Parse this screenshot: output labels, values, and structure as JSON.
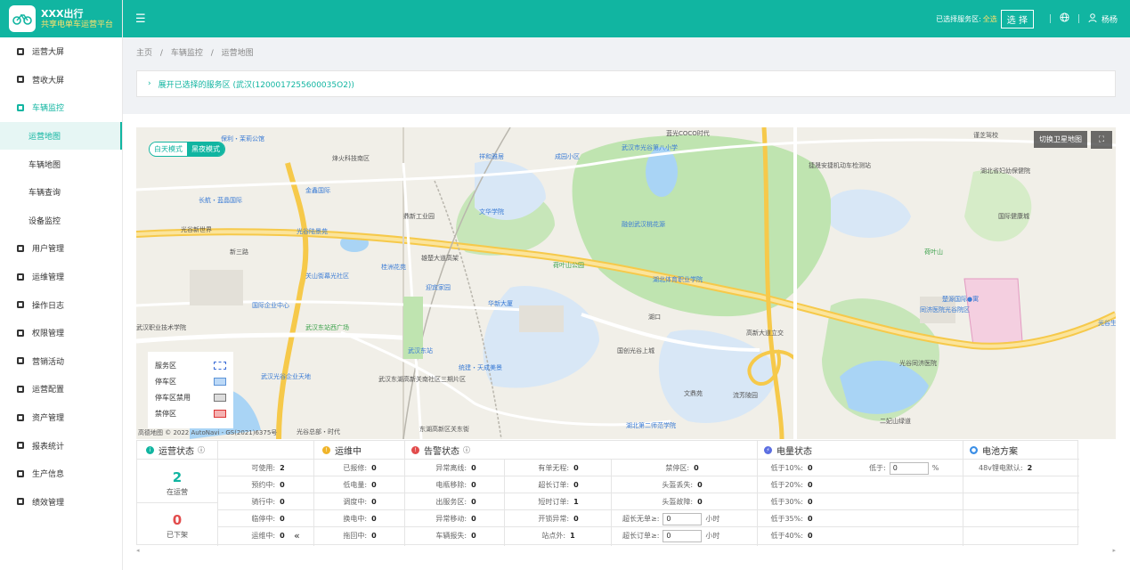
{
  "brand": {
    "title": "XXX出行",
    "subtitle": "共享电单车运营平台"
  },
  "sidebar": {
    "items": [
      {
        "label": "运营大屏",
        "icon": "chart-line-icon"
      },
      {
        "label": "营收大屏",
        "icon": "moneybag-icon"
      },
      {
        "label": "车辆监控",
        "icon": "bike-icon"
      },
      {
        "label": "运营地图",
        "sub": true
      },
      {
        "label": "车辆地图",
        "sub": true
      },
      {
        "label": "车辆查询",
        "sub": true
      },
      {
        "label": "设备监控",
        "sub": true
      },
      {
        "label": "用户管理",
        "icon": "users-icon"
      },
      {
        "label": "运维管理",
        "icon": "wrench-icon"
      },
      {
        "label": "操作日志",
        "icon": "log-icon"
      },
      {
        "label": "权限管理",
        "icon": "shield-icon"
      },
      {
        "label": "营销活动",
        "icon": "gift-icon"
      },
      {
        "label": "运营配置",
        "icon": "config-icon"
      },
      {
        "label": "资产管理",
        "icon": "asset-icon"
      },
      {
        "label": "报表统计",
        "icon": "pie-icon"
      },
      {
        "label": "生产信息",
        "icon": "production-icon"
      },
      {
        "label": "绩效管理",
        "icon": "performance-icon"
      }
    ]
  },
  "header": {
    "service_label": "已选择服务区:",
    "service_value": "全选",
    "select_btn": "选 择",
    "user": "杨杨"
  },
  "breadcrumb": [
    "主页",
    "/",
    "车辆监控",
    "/",
    "运营地图"
  ],
  "service_bar": {
    "text": "展开已选择的服务区 (武汉(1200017255600035O2))"
  },
  "map": {
    "mode_day": "白天模式",
    "mode_night": "黑夜模式",
    "satellite": "切换卫星地图",
    "legend": [
      {
        "label": "服务区"
      },
      {
        "label": "停车区"
      },
      {
        "label": "停车区禁用"
      },
      {
        "label": "禁停区"
      }
    ],
    "copyright": "高德地图 © 2022 AutoNavi - GS(2021)6375号",
    "labels": [
      {
        "t": "保利・茉莉公馆",
        "c": "b"
      },
      {
        "t": "烽火科技南区",
        "c": ""
      },
      {
        "t": "祥和雅居",
        "c": "b"
      },
      {
        "t": "成园小区",
        "c": "b"
      },
      {
        "t": "武汉市光谷第八小学",
        "c": "b"
      },
      {
        "t": "蓝光COCO时代",
        "c": ""
      },
      {
        "t": "捷晟安捷机动车检测站",
        "c": ""
      },
      {
        "t": "谨芝驾校",
        "c": ""
      },
      {
        "t": "湖北省妇幼保健院",
        "c": ""
      },
      {
        "t": "金鑫国际",
        "c": "b"
      },
      {
        "t": "长航・蓝晶国际",
        "c": "b"
      },
      {
        "t": "鼎新工业园",
        "c": ""
      },
      {
        "t": "文华学院",
        "c": "b"
      },
      {
        "t": "融创武汉桃花源",
        "c": "b"
      },
      {
        "t": "光谷新世界",
        "c": ""
      },
      {
        "t": "光谷陆景苑",
        "c": "b"
      },
      {
        "t": "新三路",
        "c": ""
      },
      {
        "t": "桂洲花苑",
        "c": "b"
      },
      {
        "t": "雄楚大道高架",
        "c": ""
      },
      {
        "t": "荷叶山公园",
        "c": "g"
      },
      {
        "t": "湖北体育职业学院",
        "c": "b"
      },
      {
        "t": "荷叶山",
        "c": "g"
      },
      {
        "t": "国际健康城",
        "c": ""
      },
      {
        "t": "关山街幕光社区",
        "c": "b"
      },
      {
        "t": "迎宾家园",
        "c": "b"
      },
      {
        "t": "华新大厦",
        "c": "b"
      },
      {
        "t": "湖口",
        "c": ""
      },
      {
        "t": "同济医院光谷院区",
        "c": "b"
      },
      {
        "t": "楚源国际●寓",
        "c": "b"
      },
      {
        "t": "国际企业中心",
        "c": "b"
      },
      {
        "t": "武汉东站西广场",
        "c": "g"
      },
      {
        "t": "武汉东站",
        "c": "b"
      },
      {
        "t": "高新大道立交",
        "c": ""
      },
      {
        "t": "光谷同济医院",
        "c": ""
      },
      {
        "t": "光谷生物城",
        "c": "b"
      },
      {
        "t": "武汉职业技术学院",
        "c": ""
      },
      {
        "t": "国创光谷上城",
        "c": ""
      },
      {
        "t": "武汉光谷企业天地",
        "c": "b"
      },
      {
        "t": "统建・天成美景",
        "c": "b"
      },
      {
        "t": "武汉东湖高新关南社区三期片区",
        "c": ""
      },
      {
        "t": "文鼎苑",
        "c": ""
      },
      {
        "t": "流芳陵园",
        "c": ""
      },
      {
        "t": "二妃山绿道",
        "c": ""
      },
      {
        "t": "东湖高新区关东街",
        "c": ""
      },
      {
        "t": "光谷总部・时代",
        "c": ""
      },
      {
        "t": "湖北第二师范学院",
        "c": "b"
      }
    ]
  },
  "panel": {
    "sections": [
      "运营状态",
      "运维中",
      "告警状态",
      "电量状态",
      "电池方案"
    ],
    "running": {
      "value": "2",
      "label": "在运营"
    },
    "offline": {
      "value": "0",
      "label": "已下架"
    },
    "op_status": [
      [
        "可使用:",
        "2"
      ],
      [
        "预约中:",
        "0"
      ],
      [
        "骑行中:",
        "0"
      ],
      [
        "临停中:",
        "0"
      ],
      [
        "运维中:",
        "0"
      ]
    ],
    "maint": [
      [
        "已报修:",
        "0"
      ],
      [
        "低电量:",
        "0"
      ],
      [
        "调度中:",
        "0"
      ],
      [
        "换电中:",
        "0"
      ],
      [
        "拖回中:",
        "0"
      ]
    ],
    "alarm1": [
      [
        "异常离线:",
        "0"
      ],
      [
        "电瓶移除:",
        "0"
      ],
      [
        "出服务区:",
        "0"
      ],
      [
        "异常移动:",
        "0"
      ],
      [
        "车辆报失:",
        "0"
      ]
    ],
    "alarm2": [
      [
        "有单无程:",
        "0"
      ],
      [
        "超长订单:",
        "0"
      ],
      [
        "短时订单:",
        "1"
      ],
      [
        "开锁异常:",
        "0"
      ],
      [
        "站点外:",
        "1"
      ]
    ],
    "alarm3": [
      [
        "禁停区:",
        "0"
      ],
      [
        "头盔丢失:",
        "0"
      ],
      [
        "头盔故障:",
        "0"
      ],
      [
        "超长无单≥:",
        "0",
        "小时"
      ],
      [
        "超长订单≥:",
        "0",
        "小时"
      ]
    ],
    "battery": [
      [
        "低于10%:",
        "0"
      ],
      [
        "低于20%:",
        "0"
      ],
      [
        "低于30%:",
        "0"
      ],
      [
        "低于35%:",
        "0"
      ],
      [
        "低于40%:",
        "0"
      ]
    ],
    "battery_custom": {
      "label": "低于:",
      "value": "0",
      "unit": "%"
    },
    "scheme": {
      "label": "48v锂电默认:",
      "value": "2"
    },
    "collapse": "«"
  }
}
